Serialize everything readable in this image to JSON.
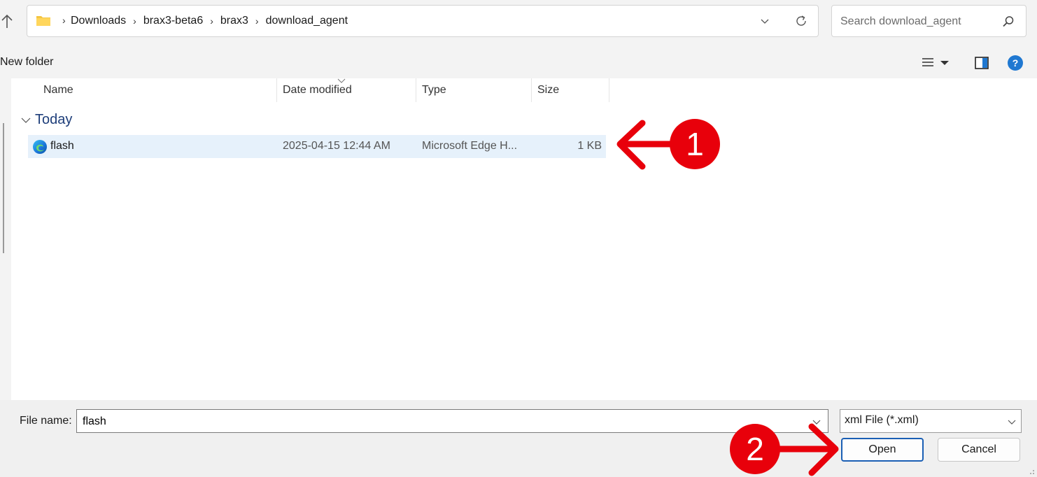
{
  "address_bar": {
    "breadcrumbs": [
      "Downloads",
      "brax3-beta6",
      "brax3",
      "download_agent"
    ]
  },
  "search": {
    "placeholder": "Search download_agent"
  },
  "command_bar": {
    "new_folder_label": "New folder"
  },
  "columns": {
    "name": "Name",
    "date": "Date modified",
    "type": "Type",
    "size": "Size"
  },
  "group": {
    "label": "Today"
  },
  "files": [
    {
      "name": "flash",
      "date": "2025-04-15 12:44 AM",
      "type": "Microsoft Edge H...",
      "size": "1 KB"
    }
  ],
  "bottom": {
    "file_name_label": "File name:",
    "file_name_value": "flash",
    "file_type_selected": "xml File (*.xml)",
    "open_label": "Open",
    "cancel_label": "Cancel"
  },
  "annotations": {
    "step1": "1",
    "step2": "2",
    "color": "#e8000b"
  },
  "colors": {
    "selected_row": "#e6f1fb",
    "accent": "#1a5fb4",
    "group_text": "#1e3e7a"
  }
}
